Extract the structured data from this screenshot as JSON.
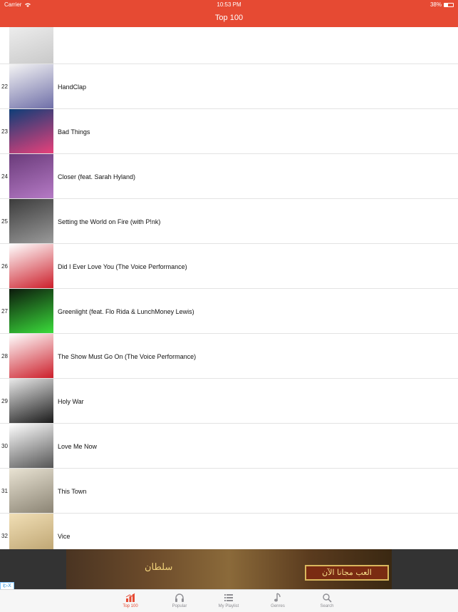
{
  "status_bar": {
    "carrier": "Carrier",
    "time": "10:53 PM",
    "battery_percent": "38%",
    "battery_level": 0.38
  },
  "header": {
    "title": "Top 100"
  },
  "tracks": [
    {
      "rank": "",
      "title": "",
      "art_colors": [
        "#f2f2f2",
        "#c9c9c9"
      ]
    },
    {
      "rank": "22",
      "title": "HandClap",
      "art_colors": [
        "#f4f4f4",
        "#6f6fa8"
      ]
    },
    {
      "rank": "23",
      "title": "Bad Things",
      "art_colors": [
        "#0e3e78",
        "#e8407a"
      ]
    },
    {
      "rank": "24",
      "title": "Closer (feat. Sarah Hyland)",
      "art_colors": [
        "#6a3b7a",
        "#b57ac5"
      ]
    },
    {
      "rank": "25",
      "title": "Setting the World on Fire (with P!nk)",
      "art_colors": [
        "#3c3c3c",
        "#9a9a9a"
      ]
    },
    {
      "rank": "26",
      "title": "Did I Ever Love You (The Voice Performance)",
      "art_colors": [
        "#ffffff",
        "#cc1f2b"
      ]
    },
    {
      "rank": "27",
      "title": "Greenlight (feat. Flo Rida & LunchMoney Lewis)",
      "art_colors": [
        "#0c1a0c",
        "#3bdc3b"
      ]
    },
    {
      "rank": "28",
      "title": "The Show Must Go On (The Voice Performance)",
      "art_colors": [
        "#ffffff",
        "#cc1f2b"
      ]
    },
    {
      "rank": "29",
      "title": "Holy War",
      "art_colors": [
        "#e9e9e9",
        "#1a1a1a"
      ]
    },
    {
      "rank": "30",
      "title": "Love Me Now",
      "art_colors": [
        "#ffffff",
        "#555555"
      ]
    },
    {
      "rank": "31",
      "title": "This Town",
      "art_colors": [
        "#e9e3d3",
        "#8b8474"
      ]
    },
    {
      "rank": "32",
      "title": "Vice",
      "art_colors": [
        "#f1dfb6",
        "#b89e6a"
      ]
    },
    {
      "rank": "",
      "title": "",
      "art_colors": [
        "#f3c9d6",
        "#e49bb3"
      ]
    }
  ],
  "ad": {
    "info_label": "i▷X",
    "cta_text": "العب مجانا الآن",
    "logo_text": "سلطان"
  },
  "tabs": [
    {
      "label": "Top 100",
      "icon": "chart-icon",
      "active": true
    },
    {
      "label": "Popular",
      "icon": "headphones-icon",
      "active": false
    },
    {
      "label": "My Playlist",
      "icon": "list-icon",
      "active": false
    },
    {
      "label": "Genres",
      "icon": "music-note-icon",
      "active": false
    },
    {
      "label": "Search",
      "icon": "search-icon",
      "active": false
    }
  ],
  "colors": {
    "accent": "#e64a33",
    "tab_inactive": "#8e8e93"
  }
}
